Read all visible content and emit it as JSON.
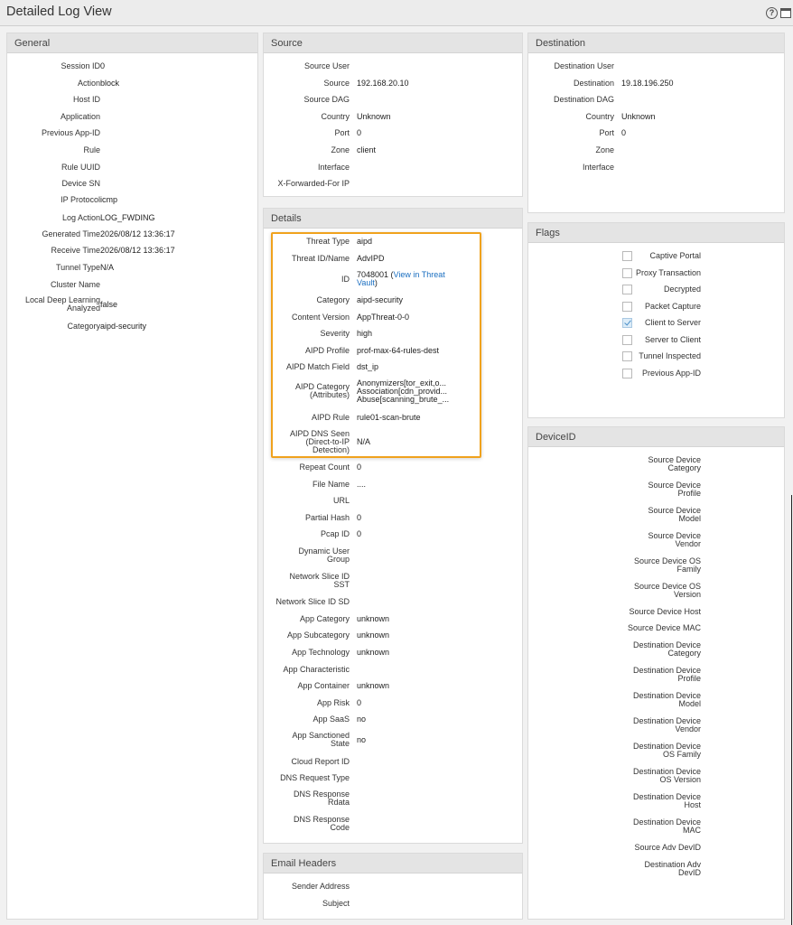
{
  "window": {
    "title": "Detailed Log View",
    "help_glyph": "?",
    "icons": [
      "help-icon",
      "maximize-icon"
    ]
  },
  "colors": {
    "highlight_border": "#f0a21d",
    "link": "#1a6ec0",
    "panel_header_bg": "#e4e4e4"
  },
  "general": {
    "title": "General",
    "rows": [
      {
        "label": "Session ID",
        "value": "0"
      },
      {
        "label": "Action",
        "value": "block"
      },
      {
        "label": "Host ID",
        "value": ""
      },
      {
        "label": "Application",
        "value": ""
      },
      {
        "label": "Previous App-ID",
        "value": ""
      },
      {
        "label": "Rule",
        "value": ""
      },
      {
        "label": "Rule UUID",
        "value": ""
      },
      {
        "label": "Device SN",
        "value": ""
      },
      {
        "label": "IP Protocol",
        "value": "icmp"
      },
      {
        "label": "Log Action",
        "value": "LOG_FWDING"
      },
      {
        "label": "Generated Time",
        "value": "2026/08/12 13:36:17"
      },
      {
        "label": "Receive Time",
        "value": "2026/08/12 13:36:17"
      },
      {
        "label": "Tunnel Type",
        "value": "N/A"
      },
      {
        "label": "Cluster Name",
        "value": ""
      },
      {
        "label": "Local Deep Learning\nAnalyzed",
        "value": "false"
      },
      {
        "label": "Category",
        "value": "aipd-security"
      }
    ]
  },
  "source": {
    "title": "Source",
    "rows": [
      {
        "label": "Source User",
        "value": ""
      },
      {
        "label": "Source",
        "value": "192.168.20.10"
      },
      {
        "label": "Source DAG",
        "value": ""
      },
      {
        "label": "Country",
        "value": "Unknown"
      },
      {
        "label": "Port",
        "value": "0"
      },
      {
        "label": "Zone",
        "value": "client"
      },
      {
        "label": "Interface",
        "value": ""
      },
      {
        "label": "X-Forwarded-For IP",
        "value": ""
      }
    ]
  },
  "destination": {
    "title": "Destination",
    "rows": [
      {
        "label": "Destination User",
        "value": ""
      },
      {
        "label": "Destination",
        "value": "19.18.196.250"
      },
      {
        "label": "Destination DAG",
        "value": ""
      },
      {
        "label": "Country",
        "value": "Unknown"
      },
      {
        "label": "Port",
        "value": "0"
      },
      {
        "label": "Zone",
        "value": ""
      },
      {
        "label": "Interface",
        "value": ""
      }
    ]
  },
  "details": {
    "title": "Details",
    "rows": [
      {
        "label": "Threat Type",
        "value": "aipd"
      },
      {
        "label": "Threat ID/Name",
        "value": "AdvIPD"
      },
      {
        "label": "ID",
        "value": "7048001 (",
        "link": "View in Threat\nVault",
        "suffix": ")"
      },
      {
        "label": "Category",
        "value": "aipd-security"
      },
      {
        "label": "Content Version",
        "value": "AppThreat-0-0"
      },
      {
        "label": "Severity",
        "value": "high"
      },
      {
        "label": "AIPD Profile",
        "value": "prof-max-64-rules-dest"
      },
      {
        "label": "AIPD Match Field",
        "value": "dst_ip"
      },
      {
        "label": "AIPD Category\n(Attributes)",
        "value": "Anonymizers[tor_exit,o...\nAssociation[cdn_provid...\nAbuse[scanning_brute_..."
      },
      {
        "label": "AIPD Rule",
        "value": "rule01-scan-brute"
      },
      {
        "label": "AIPD DNS Seen\n(Direct-to-IP\nDetection)",
        "value": "N/A"
      },
      {
        "label": "Repeat Count",
        "value": "0"
      },
      {
        "label": "File Name",
        "value": "...."
      },
      {
        "label": "URL",
        "value": ""
      },
      {
        "label": "Partial Hash",
        "value": "0"
      },
      {
        "label": "Pcap ID",
        "value": "0"
      },
      {
        "label": "Dynamic User\nGroup",
        "value": ""
      },
      {
        "label": "Network Slice ID\nSST",
        "value": ""
      },
      {
        "label": "Network Slice ID SD",
        "value": ""
      },
      {
        "label": "App Category",
        "value": "unknown"
      },
      {
        "label": "App Subcategory",
        "value": "unknown"
      },
      {
        "label": "App Technology",
        "value": "unknown"
      },
      {
        "label": "App Characteristic",
        "value": ""
      },
      {
        "label": "App Container",
        "value": "unknown"
      },
      {
        "label": "App Risk",
        "value": "0"
      },
      {
        "label": "App SaaS",
        "value": "no"
      },
      {
        "label": "App Sanctioned\nState",
        "value": "no"
      },
      {
        "label": "Cloud Report ID",
        "value": ""
      },
      {
        "label": "DNS Request Type",
        "value": ""
      },
      {
        "label": "DNS Response\nRdata",
        "value": ""
      },
      {
        "label": "DNS Response\nCode",
        "value": ""
      }
    ]
  },
  "flags": {
    "title": "Flags",
    "rows": [
      {
        "label": "Captive Portal",
        "checked": false
      },
      {
        "label": "Proxy Transaction",
        "checked": false
      },
      {
        "label": "Decrypted",
        "checked": false
      },
      {
        "label": "Packet Capture",
        "checked": false
      },
      {
        "label": "Client to Server",
        "checked": true
      },
      {
        "label": "Server to Client",
        "checked": false
      },
      {
        "label": "Tunnel Inspected",
        "checked": false
      },
      {
        "label": "Previous App-ID",
        "checked": false
      }
    ]
  },
  "deviceid": {
    "title": "DeviceID",
    "rows": [
      {
        "label": "Source Device\nCategory",
        "value": ""
      },
      {
        "label": "Source Device\nProfile",
        "value": ""
      },
      {
        "label": "Source Device\nModel",
        "value": ""
      },
      {
        "label": "Source Device\nVendor",
        "value": ""
      },
      {
        "label": "Source Device OS\nFamily",
        "value": ""
      },
      {
        "label": "Source Device OS\nVersion",
        "value": ""
      },
      {
        "label": "Source Device Host",
        "value": ""
      },
      {
        "label": "Source Device MAC",
        "value": ""
      },
      {
        "label": "Destination Device\nCategory",
        "value": ""
      },
      {
        "label": "Destination Device\nProfile",
        "value": ""
      },
      {
        "label": "Destination Device\nModel",
        "value": ""
      },
      {
        "label": "Destination Device\nVendor",
        "value": ""
      },
      {
        "label": "Destination Device\nOS Family",
        "value": ""
      },
      {
        "label": "Destination Device\nOS Version",
        "value": ""
      },
      {
        "label": "Destination Device\nHost",
        "value": ""
      },
      {
        "label": "Destination Device\nMAC",
        "value": ""
      },
      {
        "label": "Source Adv DevID",
        "value": ""
      },
      {
        "label": "Destination Adv\nDevID",
        "value": ""
      }
    ]
  },
  "email_headers": {
    "title": "Email Headers",
    "rows": [
      {
        "label": "Sender Address",
        "value": ""
      },
      {
        "label": "Subject",
        "value": ""
      }
    ]
  }
}
